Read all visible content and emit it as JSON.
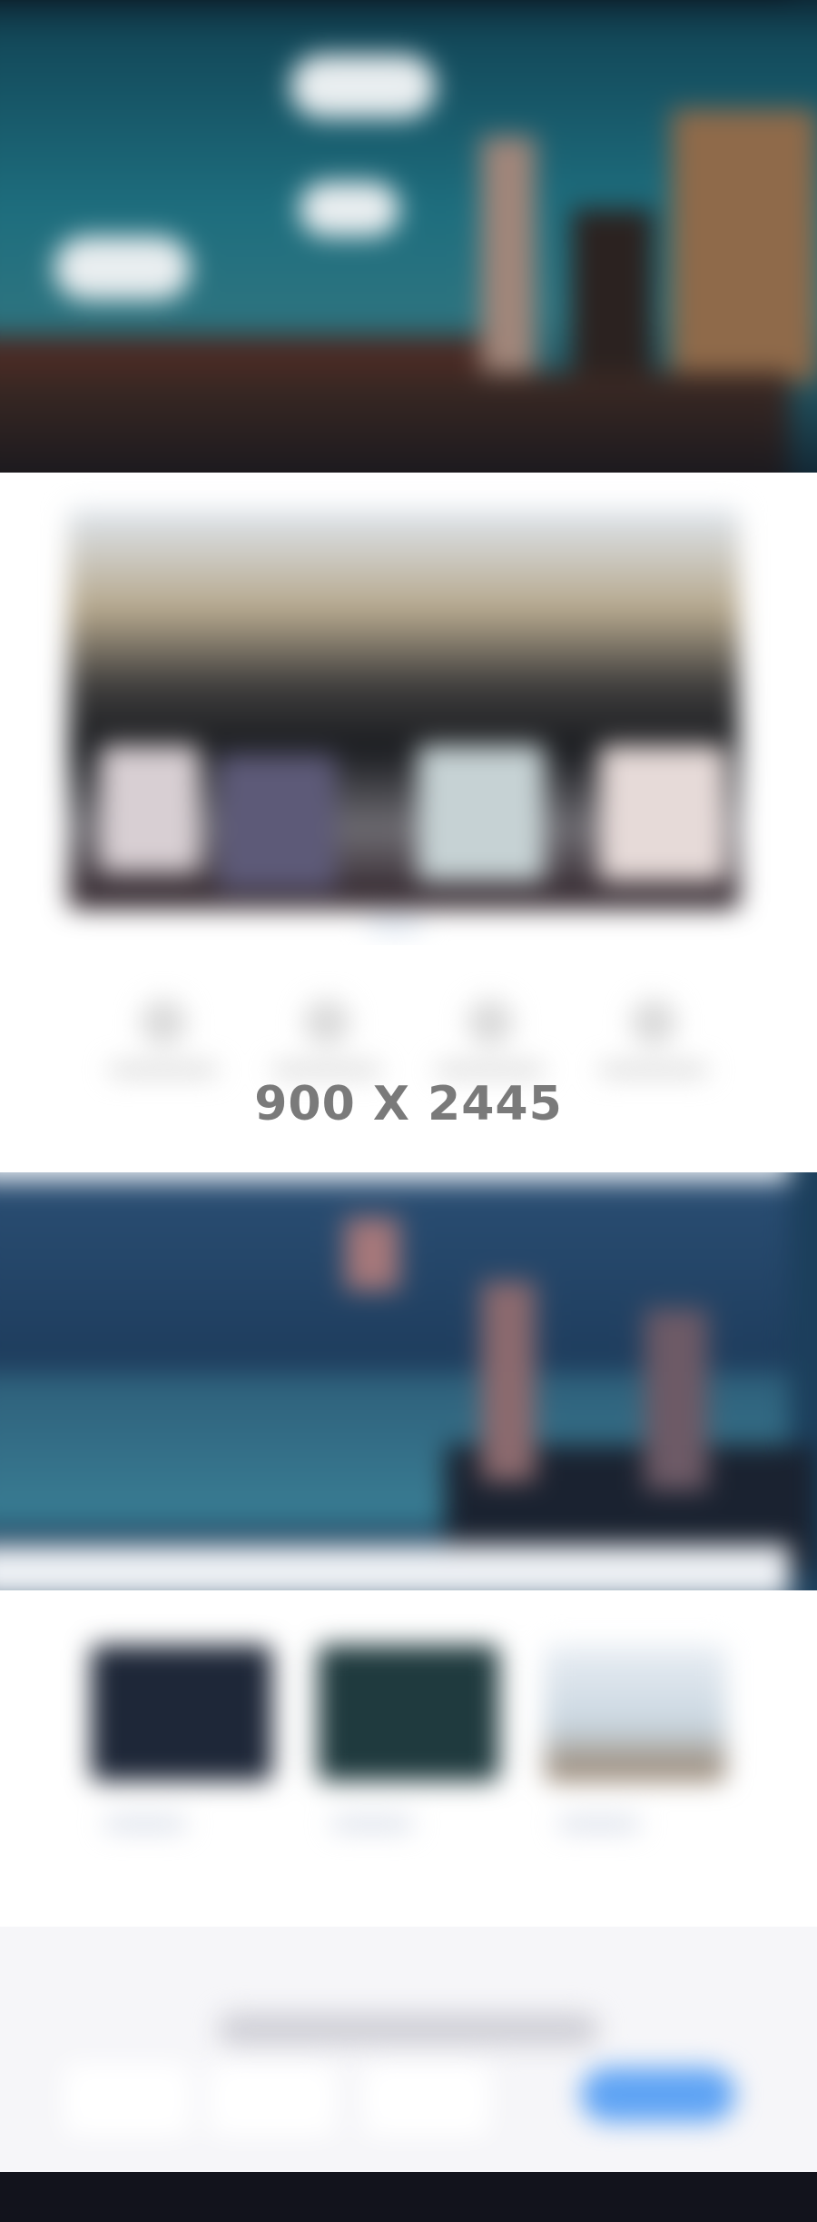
{
  "placeholder": {
    "dimensions_text": "900 X 2445"
  },
  "colors": {
    "accent_button": "#5ea3f4",
    "hero_sky": "#1e6e7e",
    "footer_bg": "#12131c"
  },
  "icons": [
    {
      "icon": "feature-icon-1"
    },
    {
      "icon": "feature-icon-2"
    },
    {
      "icon": "feature-icon-3"
    },
    {
      "icon": "feature-icon-4"
    }
  ],
  "cards": [
    {
      "icon": "card-thumbnail-1"
    },
    {
      "icon": "card-thumbnail-2"
    },
    {
      "icon": "card-thumbnail-3"
    }
  ]
}
